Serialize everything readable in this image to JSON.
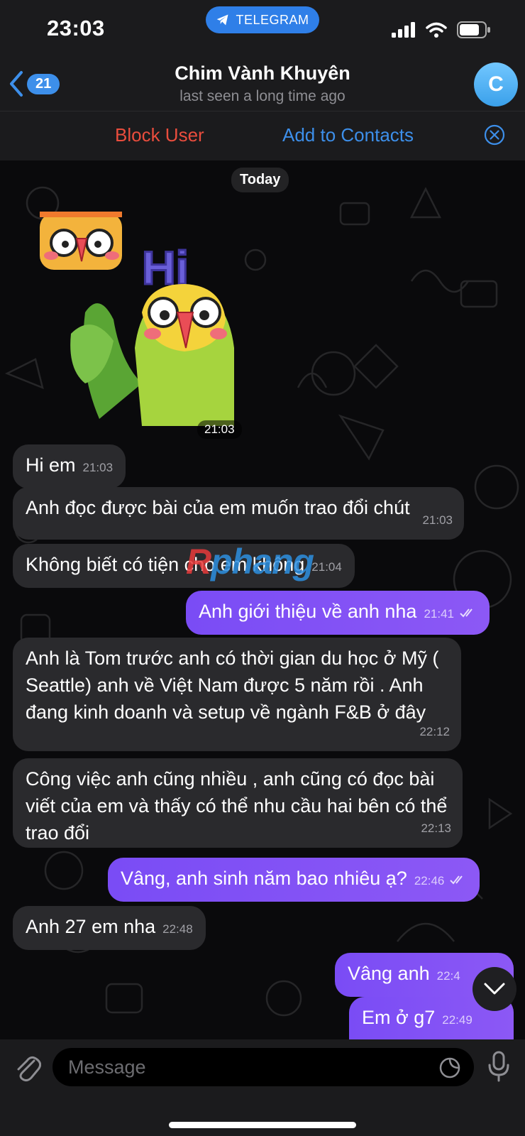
{
  "status_bar": {
    "time": "23:03",
    "app_pill": "TELEGRAM"
  },
  "header": {
    "back_count": "21",
    "title": "Chim Vành Khuyên",
    "subtitle": "last seen a long time ago",
    "avatar_letter": "C"
  },
  "actions": {
    "block": "Block User",
    "add": "Add to Contacts"
  },
  "chat": {
    "date": "Today",
    "sticker_time": "21:03",
    "watermark_a": "R",
    "watermark_b": "phang",
    "messages": [
      {
        "dir": "in",
        "text": "Hi em",
        "time": "21:03"
      },
      {
        "dir": "in",
        "text": "Anh đọc được bài của em muốn trao đổi chút",
        "time": "21:03"
      },
      {
        "dir": "in",
        "text": "Không biết có tiện cho em không",
        "time": "21:04"
      },
      {
        "dir": "out",
        "text": "Anh giới thiệu về anh nha",
        "time": "21:41"
      },
      {
        "dir": "in",
        "text": "Anh là Tom trước anh có thời gian du học ở Mỹ ( Seattle) anh về Việt Nam được 5 năm rồi . Anh đang kinh doanh và setup về ngành F&B ở đây",
        "time": "22:12"
      },
      {
        "dir": "in",
        "text": "Công việc anh cũng nhiều , anh cũng có đọc bài viết của em và thấy có thể nhu cầu hai bên có thể trao đổi",
        "time": "22:13"
      },
      {
        "dir": "out",
        "text": "Vâng, anh sinh năm bao nhiêu ạ?",
        "time": "22:46"
      },
      {
        "dir": "in",
        "text": "Anh 27 em nha",
        "time": "22:48"
      },
      {
        "dir": "out",
        "text": "Vâng anh",
        "time": "22:4"
      },
      {
        "dir": "out",
        "text": "Em ở g7",
        "time": "22:49"
      }
    ]
  },
  "input": {
    "placeholder": "Message"
  },
  "colors": {
    "accent": "#3d8fea",
    "danger": "#ea4d3d",
    "outgoing": "#8452f5",
    "incoming": "#2a2a2d"
  }
}
